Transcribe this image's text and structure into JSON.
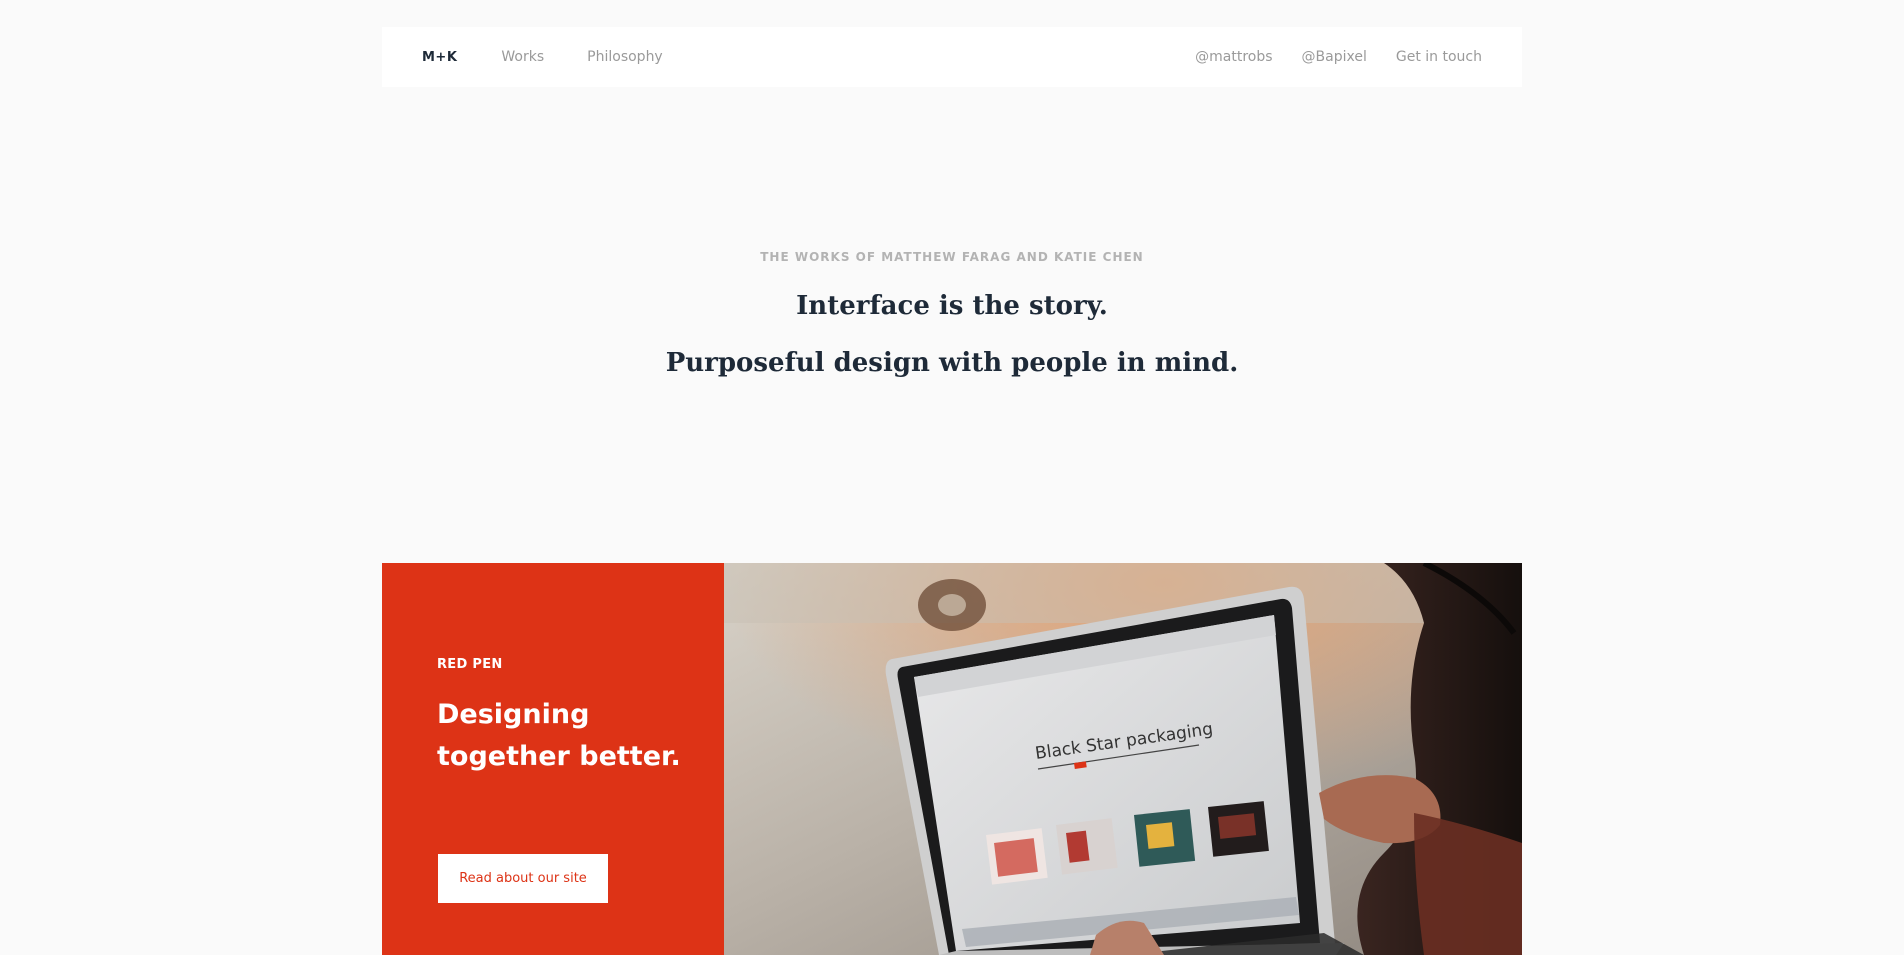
{
  "nav": {
    "logo": "M+K",
    "left_links": [
      "Works",
      "Philosophy"
    ],
    "right_links": [
      "@mattrobs",
      "@Bapixel",
      "Get in touch"
    ]
  },
  "hero": {
    "eyebrow": "THE WORKS OF MATTHEW FARAG AND KATIE CHEN",
    "line1": "Interface is the story.",
    "line2": "Purposeful design with people in mind."
  },
  "feature": {
    "kicker": "RED PEN",
    "title": "Designing together better.",
    "button_label": "Read about our site",
    "image_screen_text": "Black Star packaging",
    "accent_color": "#dd3316"
  }
}
